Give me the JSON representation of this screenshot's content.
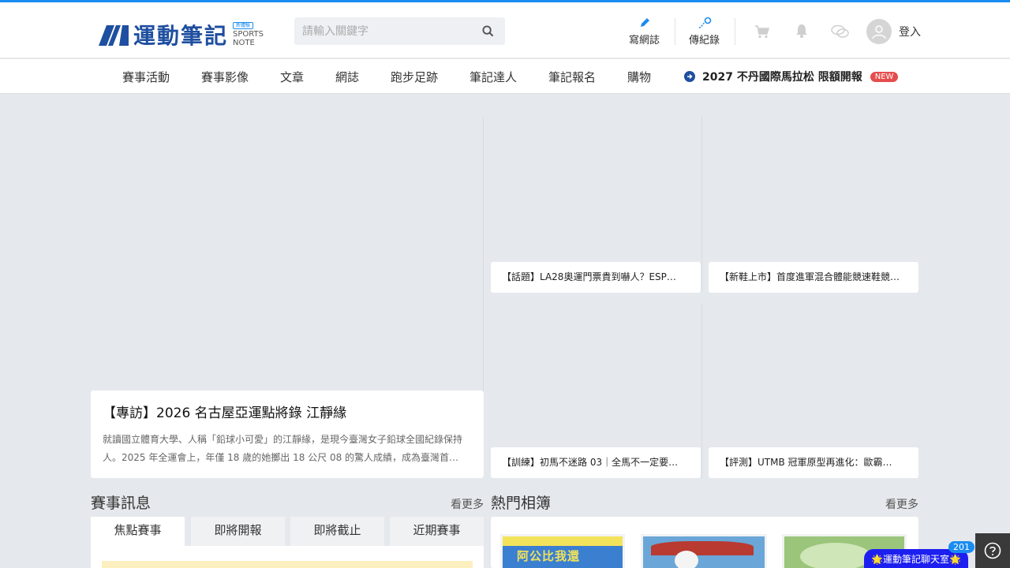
{
  "header": {
    "logo_text": "運動筆記",
    "logo_badge": "新體驗",
    "logo_sub_1": "SPORTS",
    "logo_sub_2": "NOTE",
    "search_placeholder": "請輸入關鍵字",
    "write_blog": "寫網誌",
    "upload_record": "傳紀錄",
    "login": "登入"
  },
  "nav": {
    "items": [
      "賽事活動",
      "賽事影像",
      "文章",
      "網誌",
      "跑步足跡",
      "筆記達人",
      "筆記報名",
      "購物"
    ],
    "promo": "2027 不丹國際馬拉松 限額開報",
    "promo_badge": "NEW"
  },
  "hero": {
    "title": "【專訪】2026 名古屋亞運點將錄 江靜緣",
    "desc": "就讀國立體育大學、人稱「鉛球小可愛」的江靜緣，是現今臺灣女子鉛球全國紀錄保持人。2025 年全運會上，年僅 18 歲的她擲出 18 公尺 08 的驚人成績，成為臺灣首…"
  },
  "articles": [
    "【話題】LA28奧運門票貴到嚇人？ESP…",
    "【新鞋上市】首度進軍混合體能競速鞋競…",
    "【訓練】初馬不迷路 03｜全馬不一定要…",
    "【評測】UTMB 冠軍原型再進化：歐霸…"
  ],
  "events": {
    "title": "賽事訊息",
    "more": "看更多",
    "tabs": [
      "焦點賽事",
      "即將開報",
      "即將截止",
      "近期賽事"
    ]
  },
  "albums": {
    "title": "熱門相簿",
    "more": "看更多",
    "album1_text": "阿公比我還"
  },
  "chat": {
    "label": "🌟運動筆記聊天室🌟",
    "count": "201"
  },
  "colors": {
    "brand": "#1f4fa0",
    "accent": "#1a8cf0",
    "new_badge": "#e54d4d",
    "chat": "#1d1ff0"
  }
}
